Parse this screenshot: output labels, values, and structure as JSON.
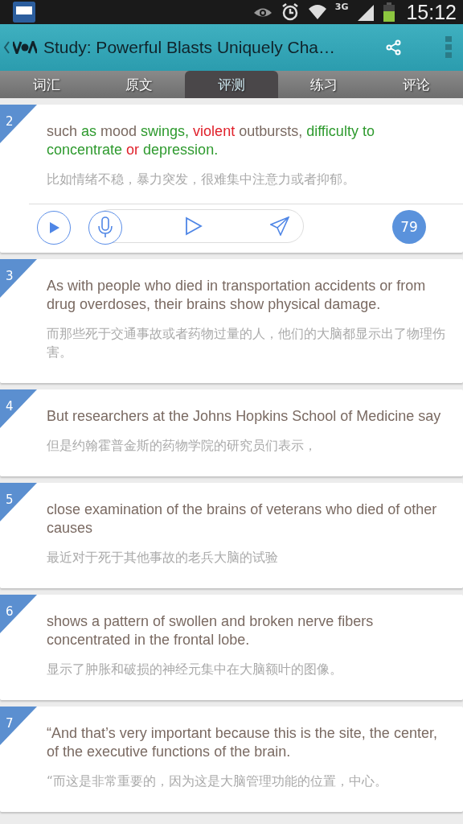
{
  "status_bar": {
    "network": "3G",
    "time": "15:12"
  },
  "app_bar": {
    "title": "Study: Powerful Blasts Uniquely Cha…"
  },
  "tabs": [
    {
      "label": "词汇",
      "selected": false
    },
    {
      "label": "原文",
      "selected": false
    },
    {
      "label": "评测",
      "selected": true
    },
    {
      "label": "练习",
      "selected": false
    },
    {
      "label": "评论",
      "selected": false
    }
  ],
  "cards": [
    {
      "number": "2",
      "segments": [
        {
          "text": "such ",
          "color": "#7a6a62"
        },
        {
          "text": "as",
          "color": "#2e9a2e"
        },
        {
          "text": " mood ",
          "color": "#7a6a62"
        },
        {
          "text": "swings, ",
          "color": "#2e9a2e"
        },
        {
          "text": "violent",
          "color": "#e0202a"
        },
        {
          "text": " outbursts, ",
          "color": "#7a6a62"
        },
        {
          "text": "difficulty to concentrate ",
          "color": "#2e9a2e"
        },
        {
          "text": "or ",
          "color": "#e0202a"
        },
        {
          "text": "depression.",
          "color": "#2e9a2e"
        }
      ],
      "translation": "比如情绪不稳，暴力突发，很难集中注意力或者抑郁。",
      "toolbar": {
        "score": "79"
      }
    },
    {
      "number": "3",
      "segments": [
        {
          "text": "As with people who died in transportation accidents or from drug overdoses, their brains show physical damage.",
          "color": "#7a6a62"
        }
      ],
      "translation": "而那些死于交通事故或者药物过量的人，他们的大脑都显示出了物理伤害。"
    },
    {
      "number": "4",
      "segments": [
        {
          "text": "But researchers at the Johns Hopkins School of Medicine say",
          "color": "#7a6a62"
        }
      ],
      "translation": "但是约翰霍普金斯的药物学院的研究员们表示，"
    },
    {
      "number": "5",
      "segments": [
        {
          "text": " close examination of the brains of veterans who died of other causes",
          "color": "#7a6a62"
        }
      ],
      "translation": "最近对于死于其他事故的老兵大脑的试验"
    },
    {
      "number": "6",
      "segments": [
        {
          "text": " shows a pattern of swollen and broken nerve fibers concentrated in the frontal lobe.",
          "color": "#7a6a62"
        }
      ],
      "translation": "显示了肿胀和破损的神经元集中在大脑额叶的图像。"
    },
    {
      "number": "7",
      "segments": [
        {
          "text": "“And that’s very important because this is the site, the center, of the executive functions of the brain.",
          "color": "#7a6a62"
        }
      ],
      "translation": "“而这是非常重要的，因为这是大脑管理功能的位置，中心。"
    }
  ]
}
